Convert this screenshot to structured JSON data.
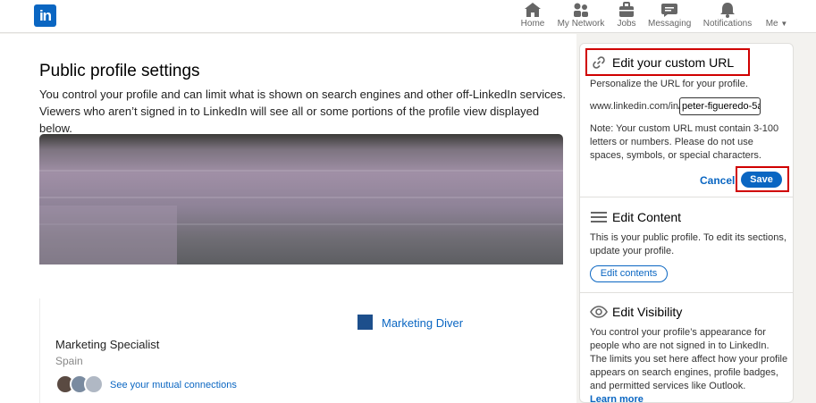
{
  "nav": {
    "logo_text": "in",
    "items": [
      {
        "label": "Home",
        "icon": "home-icon"
      },
      {
        "label": "My Network",
        "icon": "network-icon"
      },
      {
        "label": "Jobs",
        "icon": "briefcase-icon"
      },
      {
        "label": "Messaging",
        "icon": "messaging-icon"
      },
      {
        "label": "Notifications",
        "icon": "bell-icon"
      },
      {
        "label": "Me",
        "icon": "chevron-down-icon"
      }
    ]
  },
  "main": {
    "title": "Public profile settings",
    "description": "You control your profile and can limit what is shown on search engines and other off-LinkedIn services. Viewers who aren’t signed in to LinkedIn will see all or some portions of the profile view displayed below.",
    "profile": {
      "company": "Marketing Diver",
      "headline": "Marketing Specialist",
      "location": "Spain",
      "mutual_link": "See your mutual connections"
    }
  },
  "rail": {
    "custom_url": {
      "title": "Edit your custom URL",
      "intro": "Personalize the URL for your profile.",
      "prefix": "www.linkedin.com/in/",
      "value": "peter-figueredo-5a",
      "note": "Note: Your custom URL must contain 3-100 letters or numbers. Please do not use spaces, symbols, or special characters.",
      "cancel_label": "Cancel",
      "save_label": "Save"
    },
    "edit_content": {
      "title": "Edit Content",
      "text": "This is your public profile. To edit its sections, update your profile.",
      "button_label": "Edit contents"
    },
    "edit_visibility": {
      "title": "Edit Visibility",
      "text": "You control your profile’s appearance for people who are not signed in to LinkedIn. The limits you set here affect how your profile appears on search engines, profile badges, and permitted services like Outlook.",
      "learn_more": "Learn more"
    }
  },
  "colors": {
    "brand": "#0a66c2",
    "highlight": "#d00000"
  }
}
